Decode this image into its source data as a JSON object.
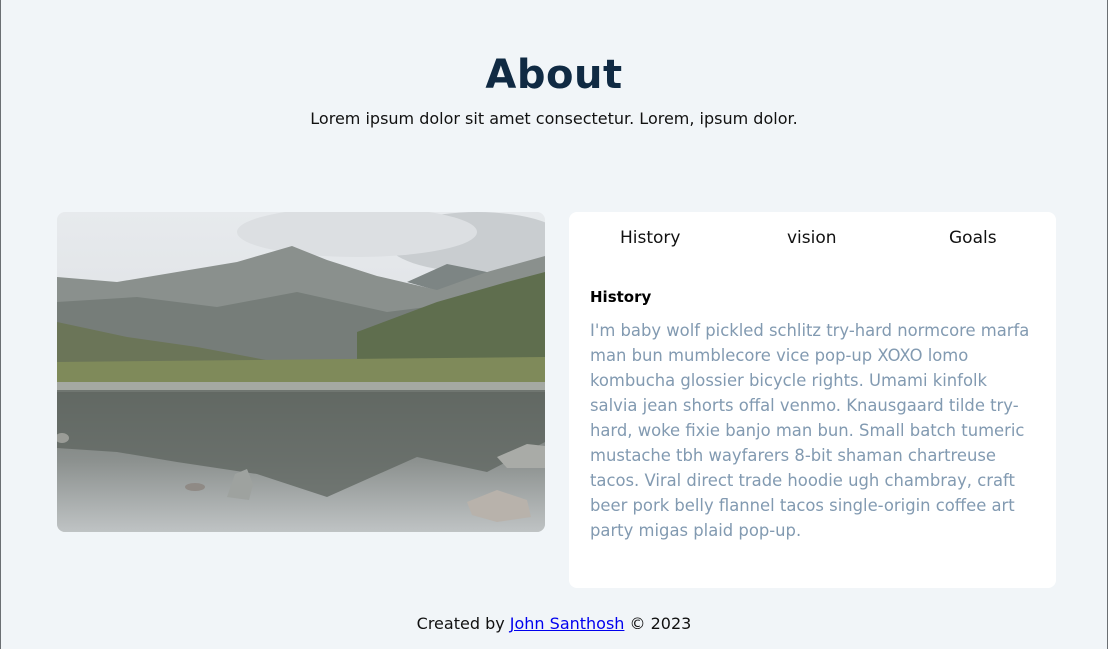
{
  "header": {
    "title": "About",
    "subtitle": "Lorem ipsum dolor sit amet consectetur. Lorem, ipsum dolor."
  },
  "tabs": [
    {
      "label": "History"
    },
    {
      "label": "vision"
    },
    {
      "label": "Goals"
    }
  ],
  "content": {
    "heading": "History",
    "text": "I'm baby wolf pickled schlitz try-hard normcore marfa man bun mumblecore vice pop-up XOXO lomo kombucha glossier bicycle rights. Umami kinfolk salvia jean shorts offal venmo. Knausgaard tilde try-hard, woke fixie banjo man bun. Small batch tumeric mustache tbh wayfarers 8-bit shaman chartreuse tacos. Viral direct trade hoodie ugh chambray, craft beer pork belly flannel tacos single-origin coffee art party migas plaid pop-up."
  },
  "footer": {
    "prefix": "Created by",
    "author": "John Santhosh",
    "suffix": "© 2023"
  },
  "colors": {
    "background": "#f1f5f8",
    "title": "#102a43",
    "body_text": "#829ab1",
    "card": "#ffffff"
  }
}
